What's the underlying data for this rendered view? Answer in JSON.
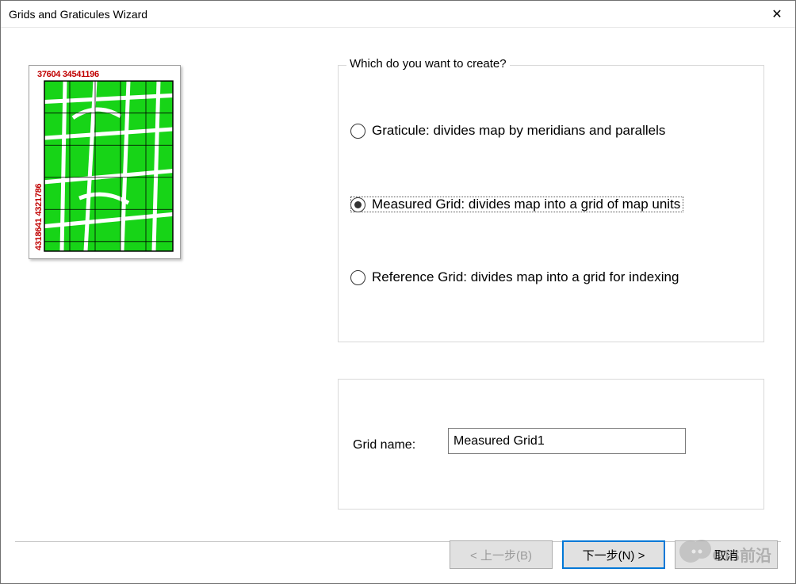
{
  "window": {
    "title": "Grids and Graticules Wizard"
  },
  "preview": {
    "coords_top": "37604    34541196",
    "coords_left": "4318641   4321786"
  },
  "options_group": {
    "legend": "Which do you want to create?",
    "radios": [
      {
        "label": "Graticule: divides map by meridians and parallels",
        "selected": false
      },
      {
        "label": "Measured Grid: divides map into a grid of map units",
        "selected": true
      },
      {
        "label": "Reference Grid: divides map into a grid for indexing",
        "selected": false
      }
    ]
  },
  "name_group": {
    "label": "Grid name:",
    "value": "Measured Grid1"
  },
  "buttons": {
    "back": "< 上一步(B)",
    "next": "下一步(N) >",
    "cancel": "取消"
  },
  "watermark": "GIS前沿"
}
